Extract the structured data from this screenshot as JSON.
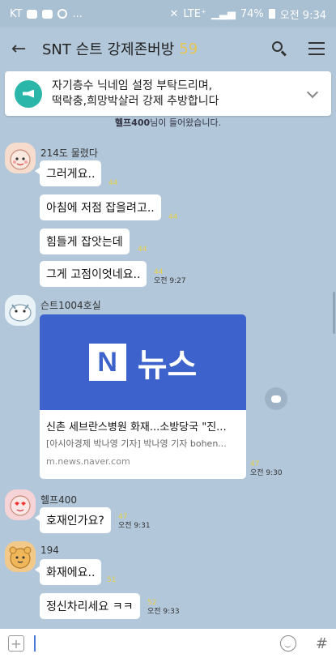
{
  "status_bar": {
    "carrier": "KT",
    "battery": "74%",
    "time": "오전 9:34",
    "network": "LTE⁺"
  },
  "header": {
    "title": "SNT 슨트 강제존버방",
    "member_count": "59"
  },
  "notice": {
    "line1": "자기층수 닉네임 설정 부탁드리며,",
    "line2": "떡락충,희망박살러 강제 추방합니다"
  },
  "system_message": {
    "name": "헬프400",
    "text": "님이 들어왔습니다."
  },
  "messages": [
    {
      "sender": "214도 물렸다",
      "bubbles": [
        {
          "text": "그러게요..",
          "unread": "44",
          "time": ""
        },
        {
          "text": "아침에 저점 잡을려고..",
          "unread": "44",
          "time": ""
        },
        {
          "text": "힘들게 잡앗는데",
          "unread": "44",
          "time": ""
        },
        {
          "text": "그게 고점이엇네요..",
          "unread": "44",
          "time": "오전 9:27"
        }
      ]
    },
    {
      "sender": "슨트1004호실",
      "link": {
        "image_label": "뉴스",
        "logo_letter": "N",
        "title": "신촌 세브란스병원 화재...소방당국 \"진...",
        "desc": "[아시아경제 박나영 기자] 박나영 기자 bohen...",
        "url": "m.news.naver.com"
      },
      "unread": "47",
      "time": "오전 9:30"
    },
    {
      "sender": "헬프400",
      "bubbles": [
        {
          "text": "호재인가요?",
          "unread": "47",
          "time": "오전 9:31"
        }
      ]
    },
    {
      "sender": "194",
      "bubbles": [
        {
          "text": "화재에요..",
          "unread": "51",
          "time": ""
        },
        {
          "text": "정신차리세요 ㅋㅋ",
          "unread": "52",
          "time": "오전 9:33"
        }
      ]
    }
  ],
  "input_bar": {
    "plus_label": "+",
    "hash_label": "#"
  },
  "colors": {
    "chat_background": "#b2c7d9",
    "member_count": "#e8c550",
    "notice_icon": "#2ab7a9",
    "news_card": "#3d62cc",
    "unread": "#e8d24a"
  }
}
